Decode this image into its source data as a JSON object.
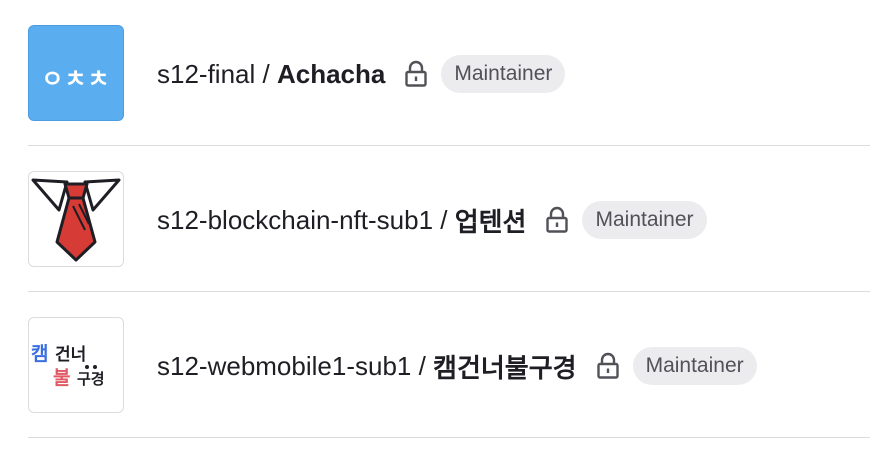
{
  "projects": [
    {
      "namespace": "s12-final",
      "separator": " / ",
      "name": "Achacha",
      "avatar_text": "ㅇㅊㅊ",
      "role": "Maintainer",
      "private": true
    },
    {
      "namespace": "s12-blockchain-nft-sub1",
      "separator": " / ",
      "name": "업텐션",
      "avatar_text": "",
      "role": "Maintainer",
      "private": true
    },
    {
      "namespace": "s12-webmobile1-sub1",
      "separator": " / ",
      "name": "캠건너불구경",
      "avatar_text": "캠건너불구경",
      "role": "Maintainer",
      "private": true
    }
  ],
  "colors": {
    "avatar_blue": "#5aaeef",
    "badge_bg": "#ececef",
    "tie_red": "#d63b35",
    "divider": "#dcdcde"
  },
  "icons": [
    "lock-icon",
    "tie-icon"
  ]
}
